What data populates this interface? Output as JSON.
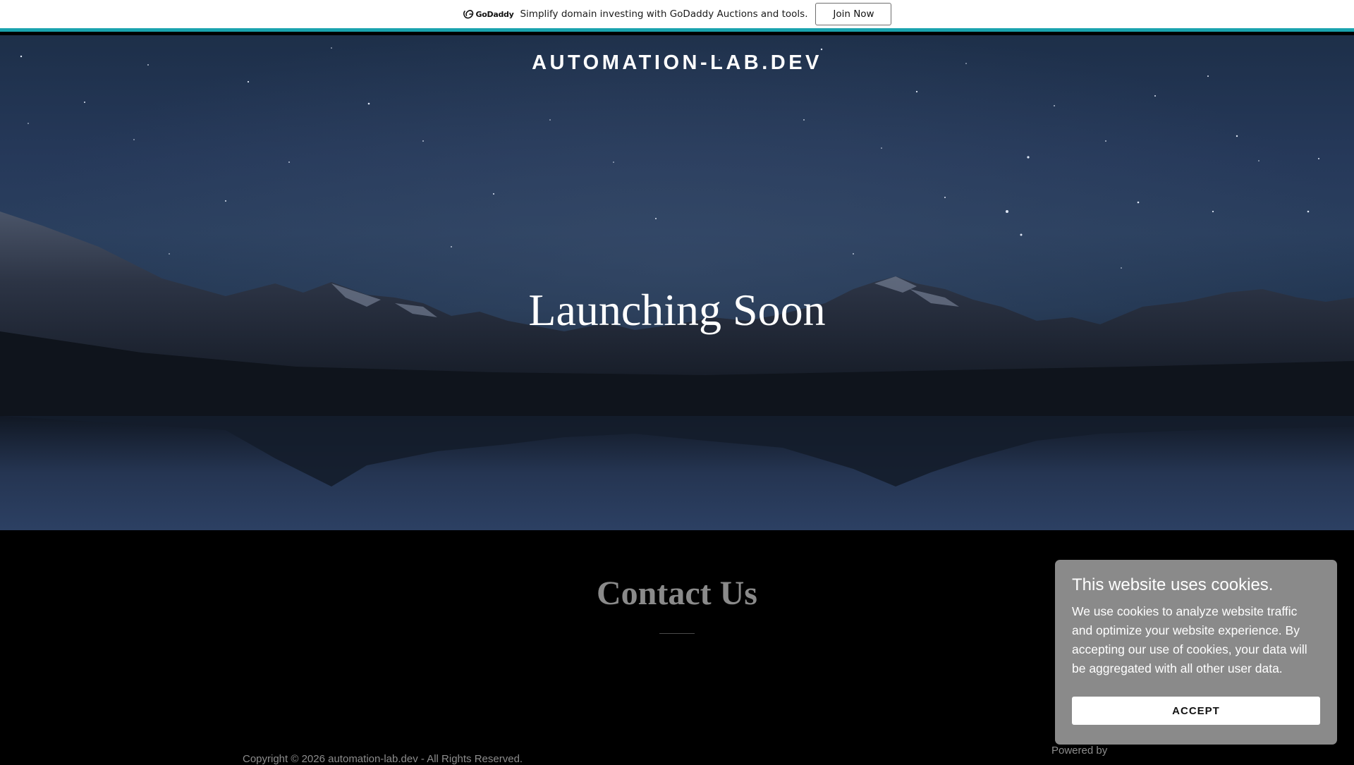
{
  "promo": {
    "logo_text": "GoDaddy",
    "message": "Simplify domain investing with GoDaddy Auctions and tools.",
    "button_label": "Join Now",
    "accent_color": "#1aa3ae"
  },
  "header": {
    "site_title": "AUTOMATION-LAB.DEV"
  },
  "hero": {
    "heading": "Launching Soon"
  },
  "contact": {
    "title": "Contact Us"
  },
  "footer": {
    "copyright": "Copyright © 2026 automation-lab.dev - All Rights Reserved.",
    "powered_by": "Powered by"
  },
  "cookie_banner": {
    "title": "This website uses cookies.",
    "body": "We use cookies to analyze website traffic and optimize your website experience. By accepting our use of cookies, your data will be aggregated with all other user data.",
    "accept_label": "ACCEPT"
  }
}
